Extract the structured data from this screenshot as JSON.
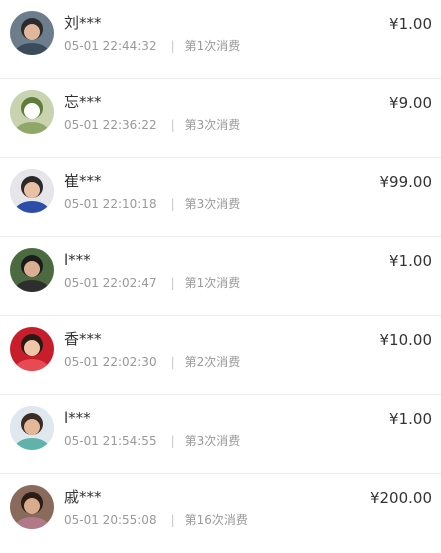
{
  "records": [
    {
      "name": "刘***",
      "time": "05-01 22:44:32",
      "separator": "|",
      "purchase_count": "第1次消费",
      "amount": "¥1.00",
      "avatar": {
        "bg": "#6c7d8c",
        "face": "#e0b79a",
        "hair": "#2b2b2b",
        "accent": "#3a4b5c"
      }
    },
    {
      "name": "忘***",
      "time": "05-01 22:36:22",
      "separator": "|",
      "purchase_count": "第3次消费",
      "amount": "¥9.00",
      "avatar": {
        "bg": "#c9d3b0",
        "face": "#ffffff",
        "hair": "#5f7d3a",
        "accent": "#8fa868"
      }
    },
    {
      "name": "崔***",
      "time": "05-01 22:10:18",
      "separator": "|",
      "purchase_count": "第3次消费",
      "amount": "¥99.00",
      "avatar": {
        "bg": "#e6e6ea",
        "face": "#e8c1a5",
        "hair": "#2a2a2a",
        "accent": "#2d4ea8"
      }
    },
    {
      "name": "l***",
      "time": "05-01 22:02:47",
      "separator": "|",
      "purchase_count": "第1次消费",
      "amount": "¥1.00",
      "avatar": {
        "bg": "#4c6a3f",
        "face": "#d9b092",
        "hair": "#1c1c1c",
        "accent": "#2e2e2e"
      }
    },
    {
      "name": "香***",
      "time": "05-01 22:02:30",
      "separator": "|",
      "purchase_count": "第2次消费",
      "amount": "¥10.00",
      "avatar": {
        "bg": "#c81e2c",
        "face": "#efc6a8",
        "hair": "#2a1a16",
        "accent": "#e84a52"
      }
    },
    {
      "name": "l***",
      "time": "05-01 21:54:55",
      "separator": "|",
      "purchase_count": "第3次消费",
      "amount": "¥1.00",
      "avatar": {
        "bg": "#dfe8ef",
        "face": "#e2b898",
        "hair": "#3a2c22",
        "accent": "#5fb3a8"
      }
    },
    {
      "name": "戚***",
      "time": "05-01 20:55:08",
      "separator": "|",
      "purchase_count": "第16次消费",
      "amount": "¥200.00",
      "avatar": {
        "bg": "#8a6a5a",
        "face": "#d8ac8c",
        "hair": "#2a1c16",
        "accent": "#b07a88"
      }
    }
  ]
}
